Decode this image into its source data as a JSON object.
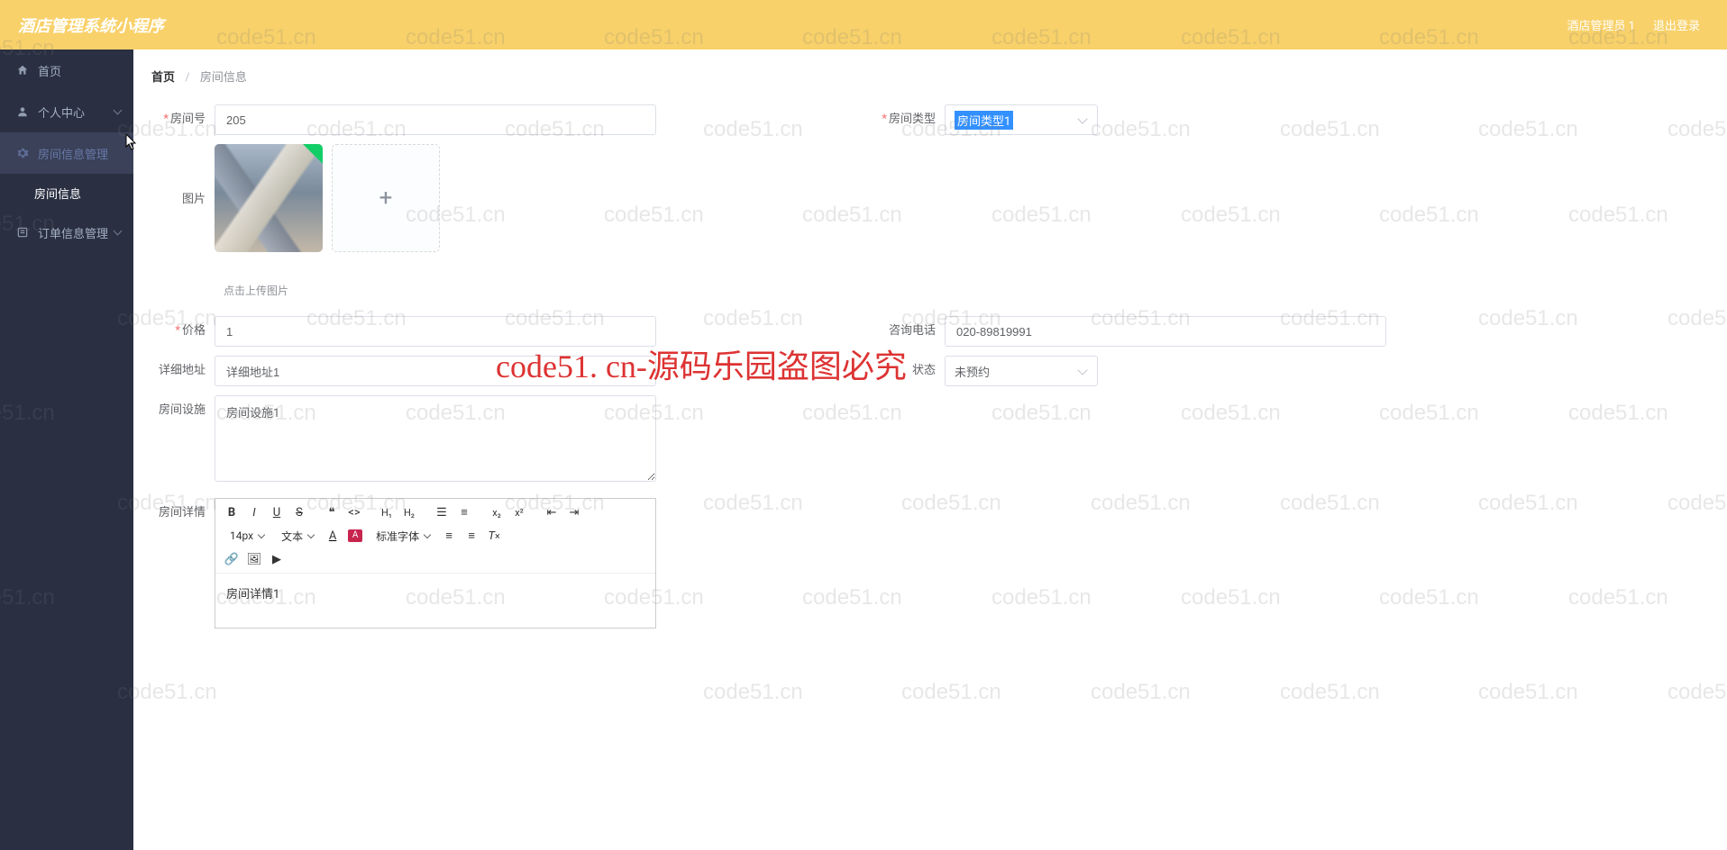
{
  "header": {
    "title": "酒店管理系统小程序",
    "user_label": "酒店管理员 1",
    "logout_label": "退出登录"
  },
  "sidebar": {
    "home": "首页",
    "personal": "个人中心",
    "room_manage": "房间信息管理",
    "room_info": "房间信息",
    "order_manage": "订单信息管理"
  },
  "breadcrumb": {
    "home": "首页",
    "current": "房间信息"
  },
  "form": {
    "room_no_label": "房间号",
    "room_no_value": "205",
    "room_type_label": "房间类型",
    "room_type_value": "房间类型1",
    "image_label": "图片",
    "image_hint": "点击上传图片",
    "price_label": "价格",
    "price_value": "1",
    "phone_label": "咨询电话",
    "phone_value": "020-89819991",
    "address_label": "详细地址",
    "address_value": "详细地址1",
    "status_label": "状态",
    "status_value": "未预约",
    "facility_label": "房间设施",
    "facility_value": "房间设施1",
    "detail_label": "房间详情",
    "detail_value": "房间详情1"
  },
  "editor": {
    "font_size": "14px",
    "heading": "文本",
    "font_family": "标准字体"
  },
  "watermark": {
    "text": "code51.cn",
    "big": "code51. cn-源码乐园盗图必究"
  }
}
